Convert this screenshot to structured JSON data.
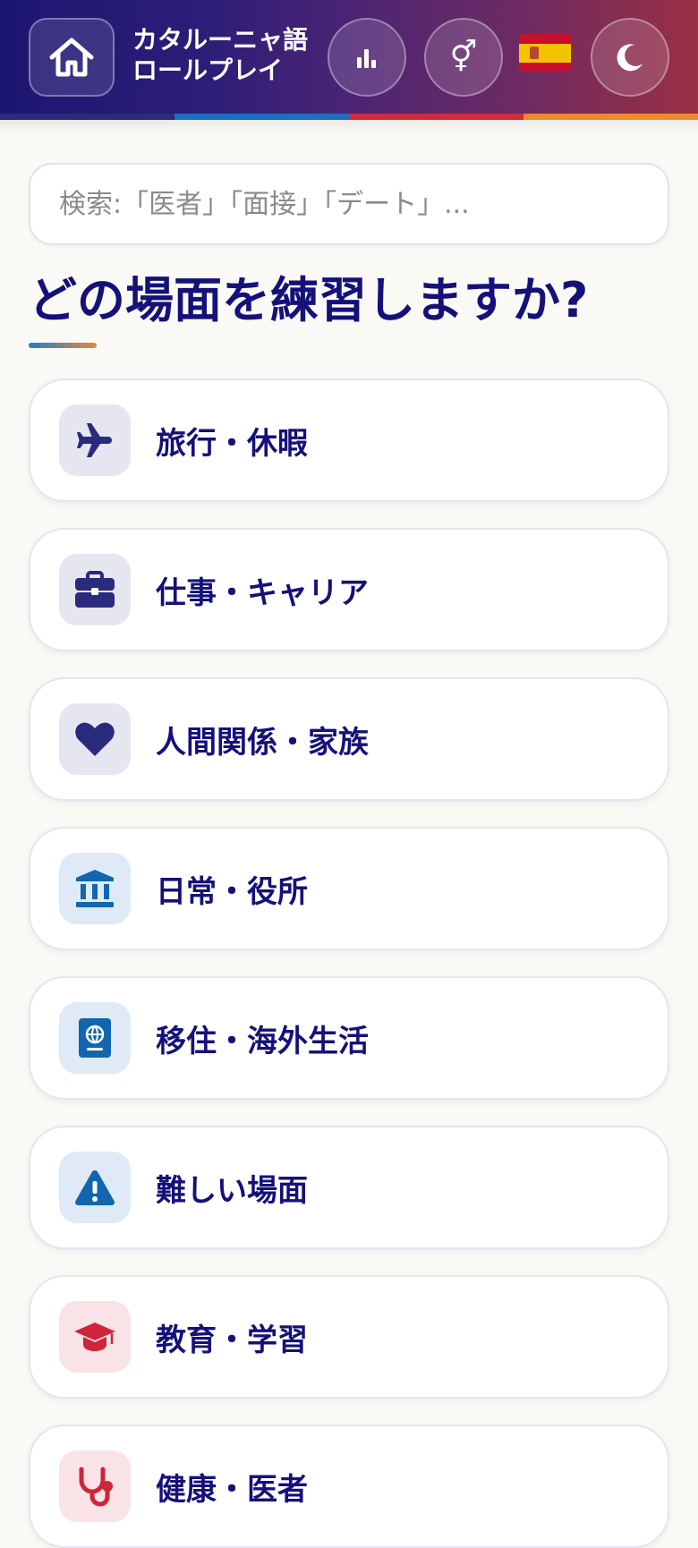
{
  "header": {
    "title_line1": "カタルーニャ語",
    "title_line2": "ロールプレイ",
    "stripe_colors": [
      "#2b2b7a",
      "#1a6fc0",
      "#d42a3c",
      "#ef8a2c"
    ],
    "home_icon": "home-icon",
    "stats_icon": "bar-chart-icon",
    "gender_icon": "gender-symbol-icon",
    "gender_glyph": "⚥",
    "language_flag": "spain-flag-icon",
    "theme_icon": "moon-icon"
  },
  "search": {
    "placeholder": "検索:「医者」「面接」「デート」..."
  },
  "page": {
    "heading": "どの場面を練習しますか?"
  },
  "categories": [
    {
      "label": "旅行・休暇",
      "icon": "airplane-icon",
      "tone": "navy"
    },
    {
      "label": "仕事・キャリア",
      "icon": "briefcase-icon",
      "tone": "navy"
    },
    {
      "label": "人間関係・家族",
      "icon": "heart-icon",
      "tone": "navy"
    },
    {
      "label": "日常・役所",
      "icon": "government-building-icon",
      "tone": "blue"
    },
    {
      "label": "移住・海外生活",
      "icon": "passport-icon",
      "tone": "blue"
    },
    {
      "label": "難しい場面",
      "icon": "warning-icon",
      "tone": "blue"
    },
    {
      "label": "教育・学習",
      "icon": "graduation-cap-icon",
      "tone": "red"
    },
    {
      "label": "健康・医者",
      "icon": "stethoscope-icon",
      "tone": "red"
    }
  ],
  "colors": {
    "primary_text": "#14117a",
    "page_background": "#faf9f5",
    "navy_icon": "#2a2a7e",
    "blue_icon": "#1266b0",
    "red_icon": "#cf2439"
  }
}
